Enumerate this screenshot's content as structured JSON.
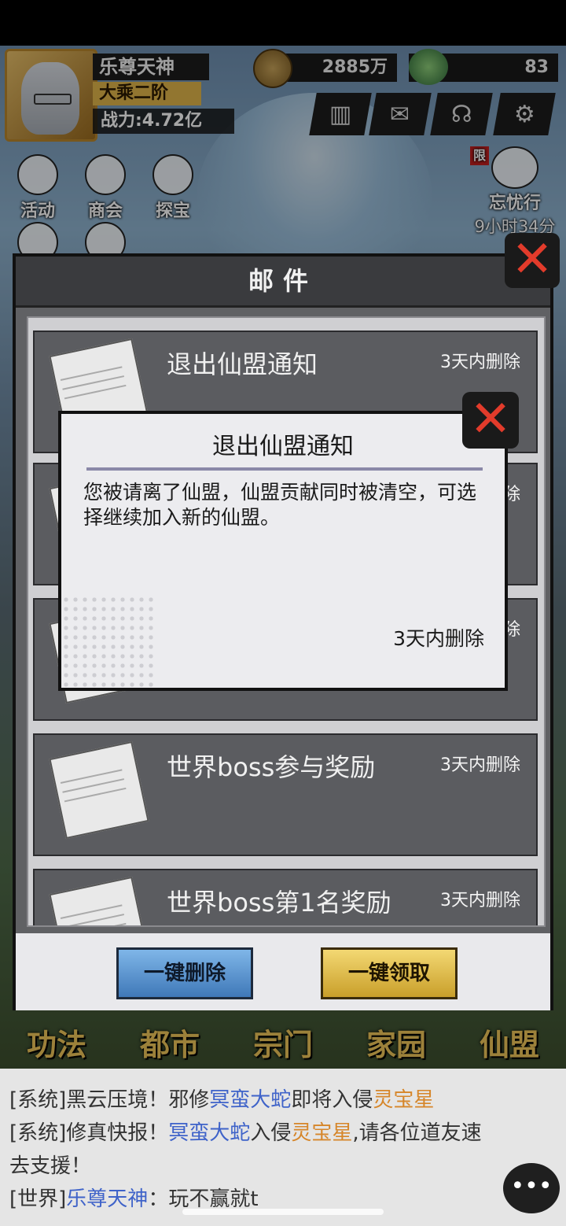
{
  "player": {
    "name": "乐尊天神",
    "rank": "大乘二阶",
    "power": "战力:4.72亿"
  },
  "resources": {
    "coins": "2885万",
    "jade": "83"
  },
  "hud_icons": [
    "rank-icon",
    "mail-icon",
    "headset-icon",
    "gear-icon"
  ],
  "menu": {
    "activity": "活动",
    "shop": "商会",
    "treasure": "探宝"
  },
  "event": {
    "badge": "限",
    "name": "忘忧行",
    "timer": "9小时34分"
  },
  "bottom_nav": [
    "功法",
    "都市",
    "宗门",
    "家园",
    "仙盟"
  ],
  "mail": {
    "header": "邮件",
    "items": [
      {
        "title": "退出仙盟通知",
        "expire": "3天内删除"
      },
      {
        "title": "",
        "expire": "3天内删除"
      },
      {
        "title": "",
        "expire": "3天内删除"
      },
      {
        "title": "世界boss参与奖励",
        "expire": "3天内删除"
      },
      {
        "title": "世界boss第1名奖励",
        "expire": "3天内删除"
      }
    ],
    "delete_all": "一键删除",
    "claim_all": "一键领取"
  },
  "detail": {
    "title": "退出仙盟通知",
    "body": "您被请离了仙盟，仙盟贡献同时被清空，可选择继续加入新的仙盟。",
    "expire": "3天内删除"
  },
  "chat": {
    "line1": {
      "prefix": "[系统]黑云压境！邪修",
      "boss": "冥蛮大蛇",
      "mid": "即将入侵",
      "place": "灵宝星"
    },
    "line2": {
      "prefix": "[系统]修真快报！",
      "boss": "冥蛮大蛇",
      "mid": "入侵",
      "place": "灵宝星",
      "suffix": ",请各位道友速"
    },
    "line3": "去支援！",
    "line4": {
      "prefix": "[世界]",
      "player": "乐尊天神",
      "msg": "：玩不赢就t"
    }
  }
}
